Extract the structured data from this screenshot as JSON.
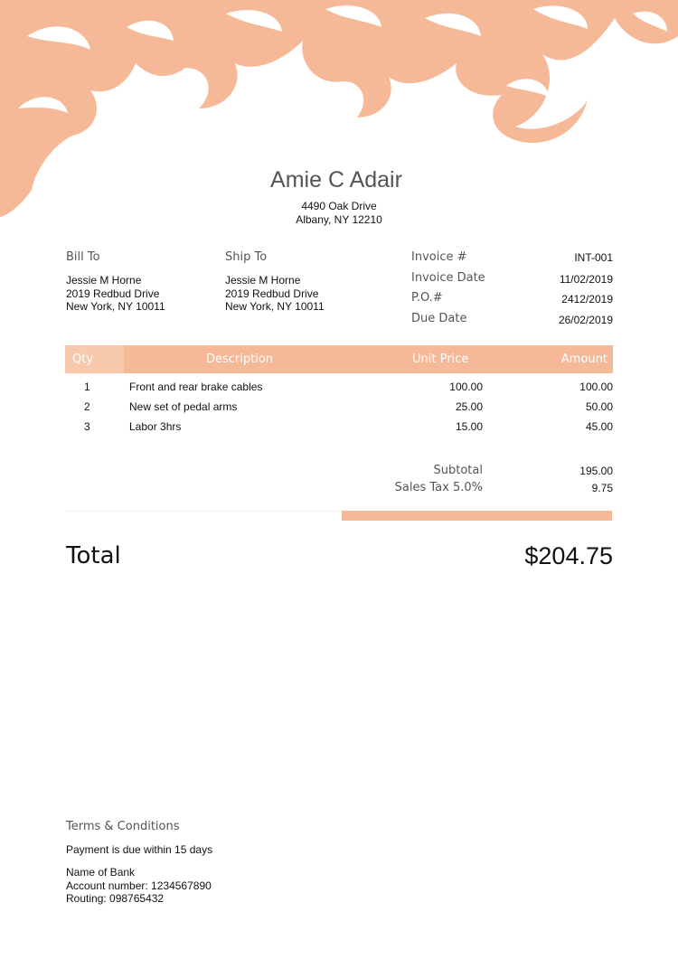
{
  "sender": {
    "name": "Amie C Adair",
    "address_line1": "4490 Oak Drive",
    "address_line2": "Albany, NY 12210"
  },
  "bill_to": {
    "label": "Bill To",
    "name": "Jessie M Horne",
    "line1": "2019 Redbud Drive",
    "line2": "New York, NY 10011"
  },
  "ship_to": {
    "label": "Ship To",
    "name": "Jessie M Horne",
    "line1": "2019 Redbud Drive",
    "line2": "New York, NY 10011"
  },
  "invoice_meta": [
    {
      "label": "Invoice #",
      "value": "INT-001"
    },
    {
      "label": "Invoice Date",
      "value": "11/02/2019"
    },
    {
      "label": "P.O.#",
      "value": "2412/2019"
    },
    {
      "label": "Due Date",
      "value": "26/02/2019"
    }
  ],
  "table": {
    "headers": {
      "qty": "Qty",
      "description": "Description",
      "unit_price": "Unit Price",
      "amount": "Amount"
    },
    "rows": [
      {
        "qty": "1",
        "description": "Front and rear brake cables",
        "unit_price": "100.00",
        "amount": "100.00"
      },
      {
        "qty": "2",
        "description": "New set of pedal arms",
        "unit_price": "25.00",
        "amount": "50.00"
      },
      {
        "qty": "3",
        "description": "Labor 3hrs",
        "unit_price": "15.00",
        "amount": "45.00"
      }
    ]
  },
  "summary": {
    "subtotal_label": "Subtotal",
    "subtotal_value": "195.00",
    "tax_label": "Sales Tax 5.0%",
    "tax_value": "9.75"
  },
  "total": {
    "label": "Total",
    "value": "$204.75"
  },
  "terms": {
    "heading": "Terms & Conditions",
    "payment": "Payment is due within 15 days",
    "bank_name": "Name of Bank",
    "account": "Account number: 1234567890",
    "routing": "Routing: 098765432"
  },
  "colors": {
    "accent": "#f6b998",
    "accent_light": "#f9c9ad",
    "heading_text": "#555555"
  },
  "decoration": {
    "ornament": "floral-flourish-graphic"
  }
}
